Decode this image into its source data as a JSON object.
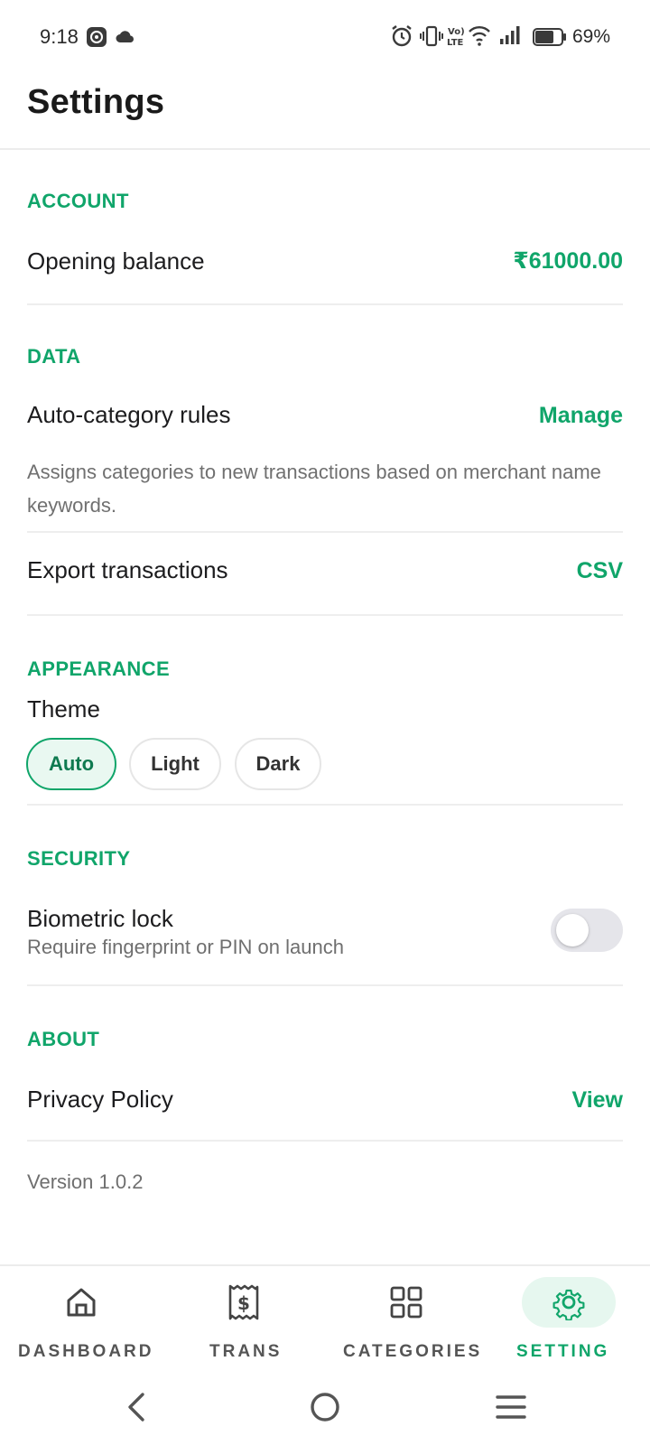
{
  "status_bar": {
    "time": "9:18",
    "battery_percent": "69%",
    "icons": [
      "settings-app-icon",
      "cloud-icon",
      "alarm-icon",
      "vibrate-icon",
      "volte-icon",
      "wifi-icon",
      "signal-icon",
      "battery-icon"
    ]
  },
  "header": {
    "title": "Settings"
  },
  "account": {
    "section_title": "ACCOUNT",
    "opening_balance_label": "Opening balance",
    "opening_balance_value": "₹61000.00"
  },
  "data": {
    "section_title": "DATA",
    "auto_category_label": "Auto-category rules",
    "auto_category_action": "Manage",
    "auto_category_desc": "Assigns categories to new transactions based on merchant name keywords.",
    "export_label": "Export transactions",
    "export_action": "CSV"
  },
  "appearance": {
    "section_title": "APPEARANCE",
    "theme_label": "Theme",
    "theme_options": [
      "Auto",
      "Light",
      "Dark"
    ],
    "theme_selected": "Auto"
  },
  "security": {
    "section_title": "SECURITY",
    "biometric_label": "Biometric lock",
    "biometric_sub": "Require fingerprint or PIN on launch",
    "biometric_enabled": false
  },
  "about": {
    "section_title": "ABOUT",
    "privacy_label": "Privacy Policy",
    "privacy_action": "View",
    "version": "Version 1.0.2"
  },
  "bottom_nav": {
    "items": [
      {
        "label": "DASHBOARD",
        "icon": "home-icon"
      },
      {
        "label": "TRANS",
        "icon": "receipt-icon"
      },
      {
        "label": "CATEGORIES",
        "icon": "grid-icon"
      },
      {
        "label": "SETTING",
        "icon": "gear-icon"
      }
    ],
    "active": "SETTING"
  },
  "colors": {
    "accent": "#10a56a",
    "accent_bg": "#e6f7ef",
    "text": "#1c1c1e",
    "muted": "#707070"
  }
}
